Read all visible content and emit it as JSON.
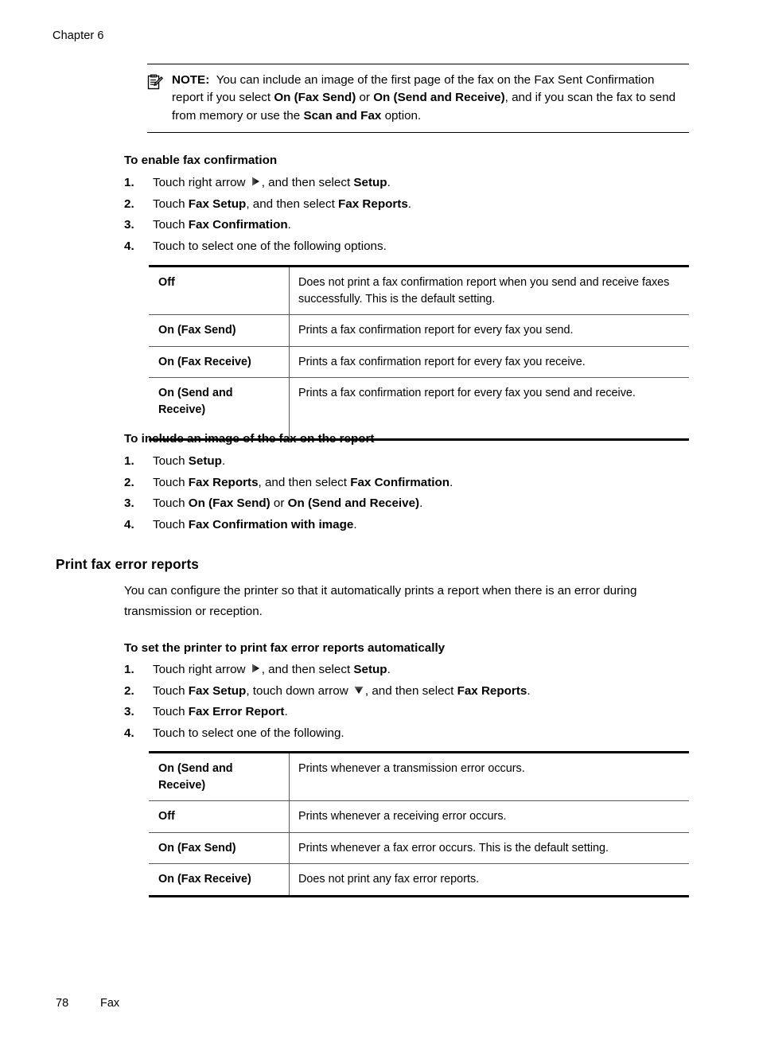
{
  "page": {
    "chapter_header": "Chapter 6",
    "footer_page_number": "78",
    "footer_section": "Fax"
  },
  "note": {
    "icon": "note-clipboard-pencil-icon",
    "label": "NOTE:",
    "text_parts": [
      {
        "type": "plain",
        "text": "You can include an image of the first page of the fax on the Fax Sent Confirmation report if you select "
      },
      {
        "type": "bold",
        "text": "On (Fax Send)"
      },
      {
        "type": "plain",
        "text": " or "
      },
      {
        "type": "bold",
        "text": "On (Send and Receive)"
      },
      {
        "type": "plain",
        "text": ", and if you scan the fax to send from memory or use the "
      },
      {
        "type": "bold",
        "text": "Scan and Fax"
      },
      {
        "type": "plain",
        "text": " option."
      }
    ],
    "full_text": "NOTE: You can include an image of the first page of the fax on the Fax Sent Confirmation report if you select On (Fax Send) or On (Send and Receive), and if you scan the fax to send from memory or use the Scan and Fax option."
  },
  "procedure_enable_confirmation": {
    "title": "To enable fax confirmation",
    "steps": [
      {
        "num": "1.",
        "segments": [
          {
            "type": "plain",
            "text": "Touch right arrow "
          },
          {
            "type": "icon",
            "icon": "right-arrow-icon"
          },
          {
            "type": "plain",
            "text": ", and then select "
          },
          {
            "type": "bold",
            "text": "Setup"
          },
          {
            "type": "plain",
            "text": "."
          }
        ]
      },
      {
        "num": "2.",
        "segments": [
          {
            "type": "plain",
            "text": "Touch "
          },
          {
            "type": "bold",
            "text": "Fax Setup"
          },
          {
            "type": "plain",
            "text": ", and then select "
          },
          {
            "type": "bold",
            "text": "Fax Reports"
          },
          {
            "type": "plain",
            "text": "."
          }
        ]
      },
      {
        "num": "3.",
        "segments": [
          {
            "type": "plain",
            "text": "Touch "
          },
          {
            "type": "bold",
            "text": "Fax Confirmation"
          },
          {
            "type": "plain",
            "text": "."
          }
        ]
      },
      {
        "num": "4.",
        "segments": [
          {
            "type": "plain",
            "text": "Touch to select one of the following options."
          }
        ]
      }
    ]
  },
  "table_fax_confirmation": {
    "rows": [
      {
        "key": "Off",
        "value": "Does not print a fax confirmation report when you send and receive faxes successfully. This is the default setting."
      },
      {
        "key": "On (Fax Send)",
        "value": "Prints a fax confirmation report for every fax you send."
      },
      {
        "key": "On (Fax Receive)",
        "value": "Prints a fax confirmation report for every fax you receive."
      },
      {
        "key": "On (Send and Receive)",
        "value": "Prints a fax confirmation report for every fax you send and receive."
      }
    ]
  },
  "procedure_include_image": {
    "title": "To include an image of the fax on the report",
    "steps": [
      {
        "num": "1.",
        "segments": [
          {
            "type": "plain",
            "text": "Touch "
          },
          {
            "type": "bold",
            "text": "Setup"
          },
          {
            "type": "plain",
            "text": "."
          }
        ]
      },
      {
        "num": "2.",
        "segments": [
          {
            "type": "plain",
            "text": "Touch "
          },
          {
            "type": "bold",
            "text": "Fax Reports"
          },
          {
            "type": "plain",
            "text": ", and then select "
          },
          {
            "type": "bold",
            "text": "Fax Confirmation"
          },
          {
            "type": "plain",
            "text": "."
          }
        ]
      },
      {
        "num": "3.",
        "segments": [
          {
            "type": "plain",
            "text": "Touch "
          },
          {
            "type": "bold",
            "text": "On (Fax Send)"
          },
          {
            "type": "plain",
            "text": " or "
          },
          {
            "type": "bold",
            "text": "On (Send and Receive)"
          },
          {
            "type": "plain",
            "text": "."
          }
        ]
      },
      {
        "num": "4.",
        "segments": [
          {
            "type": "plain",
            "text": "Touch "
          },
          {
            "type": "bold",
            "text": "Fax Confirmation with image"
          },
          {
            "type": "plain",
            "text": "."
          }
        ]
      }
    ]
  },
  "section_error_reports": {
    "heading": "Print fax error reports",
    "paragraph": "You can configure the printer so that it automatically prints a report when there is an error during transmission or reception."
  },
  "procedure_error_reports": {
    "title": "To set the printer to print fax error reports automatically",
    "steps": [
      {
        "num": "1.",
        "segments": [
          {
            "type": "plain",
            "text": "Touch right arrow "
          },
          {
            "type": "icon",
            "icon": "right-arrow-icon"
          },
          {
            "type": "plain",
            "text": ", and then select "
          },
          {
            "type": "bold",
            "text": "Setup"
          },
          {
            "type": "plain",
            "text": "."
          }
        ]
      },
      {
        "num": "2.",
        "segments": [
          {
            "type": "plain",
            "text": "Touch "
          },
          {
            "type": "bold",
            "text": "Fax Setup"
          },
          {
            "type": "plain",
            "text": ", touch down arrow "
          },
          {
            "type": "icon",
            "icon": "down-arrow-icon"
          },
          {
            "type": "plain",
            "text": ", and then select "
          },
          {
            "type": "bold",
            "text": "Fax Reports"
          },
          {
            "type": "plain",
            "text": "."
          }
        ]
      },
      {
        "num": "3.",
        "segments": [
          {
            "type": "plain",
            "text": "Touch "
          },
          {
            "type": "bold",
            "text": "Fax Error Report"
          },
          {
            "type": "plain",
            "text": "."
          }
        ]
      },
      {
        "num": "4.",
        "segments": [
          {
            "type": "plain",
            "text": "Touch to select one of the following."
          }
        ]
      }
    ]
  },
  "table_fax_error": {
    "rows": [
      {
        "key": "On (Send and Receive)",
        "value": "Prints whenever a transmission error occurs."
      },
      {
        "key": "Off",
        "value": "Prints whenever a receiving error occurs."
      },
      {
        "key": "On (Fax Send)",
        "value": "Prints whenever a fax error occurs. This is the default setting."
      },
      {
        "key": "On (Fax Receive)",
        "value": "Does not print any fax error reports."
      }
    ]
  }
}
